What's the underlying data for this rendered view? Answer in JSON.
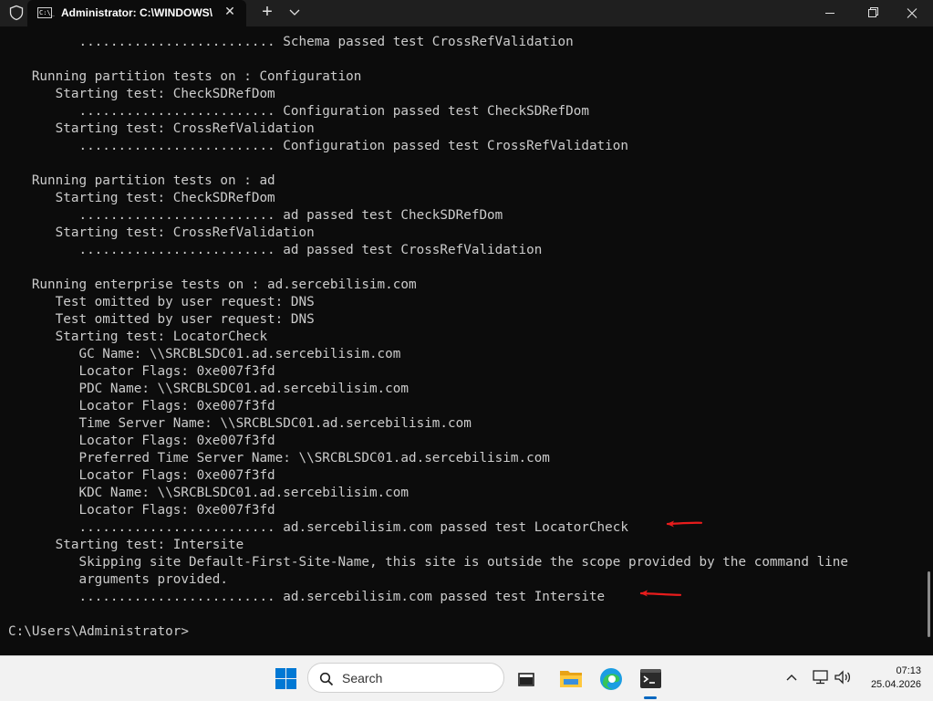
{
  "titlebar": {
    "tab_title": "Administrator: C:\\WINDOWS\\",
    "tab_icon_text": "C:\\_",
    "new_tab_glyph": "+",
    "close_tab_glyph": "✕"
  },
  "console": {
    "lines": [
      "         ......................... Schema passed test CrossRefValidation",
      "",
      "   Running partition tests on : Configuration",
      "      Starting test: CheckSDRefDom",
      "         ......................... Configuration passed test CheckSDRefDom",
      "      Starting test: CrossRefValidation",
      "         ......................... Configuration passed test CrossRefValidation",
      "",
      "   Running partition tests on : ad",
      "      Starting test: CheckSDRefDom",
      "         ......................... ad passed test CheckSDRefDom",
      "      Starting test: CrossRefValidation",
      "         ......................... ad passed test CrossRefValidation",
      "",
      "   Running enterprise tests on : ad.sercebilisim.com",
      "      Test omitted by user request: DNS",
      "      Test omitted by user request: DNS",
      "      Starting test: LocatorCheck",
      "         GC Name: \\\\SRCBLSDC01.ad.sercebilisim.com",
      "         Locator Flags: 0xe007f3fd",
      "         PDC Name: \\\\SRCBLSDC01.ad.sercebilisim.com",
      "         Locator Flags: 0xe007f3fd",
      "         Time Server Name: \\\\SRCBLSDC01.ad.sercebilisim.com",
      "         Locator Flags: 0xe007f3fd",
      "         Preferred Time Server Name: \\\\SRCBLSDC01.ad.sercebilisim.com",
      "         Locator Flags: 0xe007f3fd",
      "         KDC Name: \\\\SRCBLSDC01.ad.sercebilisim.com",
      "         Locator Flags: 0xe007f3fd",
      "         ......................... ad.sercebilisim.com passed test LocatorCheck",
      "      Starting test: Intersite",
      "         Skipping site Default-First-Site-Name, this site is outside the scope provided by the command line",
      "         arguments provided.",
      "         ......................... ad.sercebilisim.com passed test Intersite",
      "",
      "C:\\Users\\Administrator>"
    ]
  },
  "taskbar": {
    "search_label": "Search",
    "time": "07:13",
    "date": "25.04.2026"
  },
  "colors": {
    "console_bg": "#0c0c0c",
    "console_text": "#cccccc",
    "titlebar_bg": "#1f1f1f",
    "annotation_red": "#e81c1c",
    "taskbar_bg": "#f2f2f2"
  }
}
